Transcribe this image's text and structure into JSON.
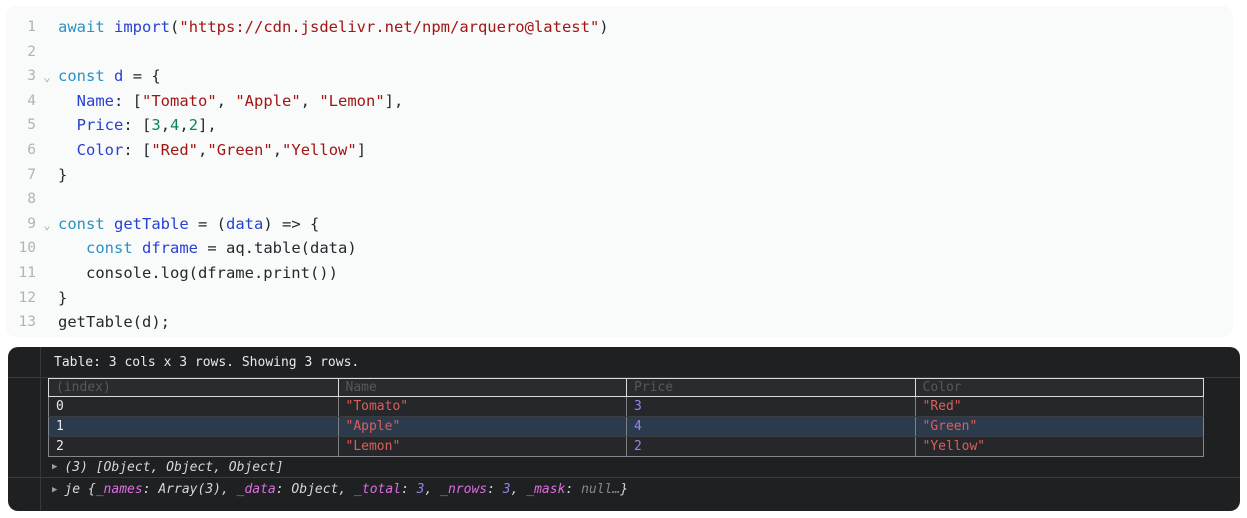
{
  "editor": {
    "fold_icon": "⌄",
    "lines": [
      {
        "num": "1",
        "fold": false,
        "tokens": [
          [
            "kw",
            "await"
          ],
          [
            "pl",
            " "
          ],
          [
            "id",
            "import"
          ],
          [
            "pl",
            "("
          ],
          [
            "str",
            "\"https://cdn.jsdelivr.net/npm/arquero@latest\""
          ],
          [
            "pl",
            ")"
          ]
        ]
      },
      {
        "num": "2",
        "fold": false,
        "tokens": []
      },
      {
        "num": "3",
        "fold": true,
        "tokens": [
          [
            "kw",
            "const"
          ],
          [
            "pl",
            " "
          ],
          [
            "id",
            "d"
          ],
          [
            "pl",
            " = {"
          ]
        ]
      },
      {
        "num": "4",
        "fold": false,
        "tokens": [
          [
            "pl",
            "  "
          ],
          [
            "id",
            "Name"
          ],
          [
            "pl",
            ": ["
          ],
          [
            "str",
            "\"Tomato\""
          ],
          [
            "pl",
            ", "
          ],
          [
            "str",
            "\"Apple\""
          ],
          [
            "pl",
            ", "
          ],
          [
            "str",
            "\"Lemon\""
          ],
          [
            "pl",
            "],"
          ]
        ]
      },
      {
        "num": "5",
        "fold": false,
        "tokens": [
          [
            "pl",
            "  "
          ],
          [
            "id",
            "Price"
          ],
          [
            "pl",
            ": ["
          ],
          [
            "num",
            "3"
          ],
          [
            "pl",
            ","
          ],
          [
            "num",
            "4"
          ],
          [
            "pl",
            ","
          ],
          [
            "num",
            "2"
          ],
          [
            "pl",
            "],"
          ]
        ]
      },
      {
        "num": "6",
        "fold": false,
        "tokens": [
          [
            "pl",
            "  "
          ],
          [
            "id",
            "Color"
          ],
          [
            "pl",
            ": ["
          ],
          [
            "str",
            "\"Red\""
          ],
          [
            "pl",
            ","
          ],
          [
            "str",
            "\"Green\""
          ],
          [
            "pl",
            ","
          ],
          [
            "str",
            "\"Yellow\""
          ],
          [
            "pl",
            "]"
          ]
        ]
      },
      {
        "num": "7",
        "fold": false,
        "tokens": [
          [
            "pl",
            "}"
          ]
        ]
      },
      {
        "num": "8",
        "fold": false,
        "tokens": []
      },
      {
        "num": "9",
        "fold": true,
        "tokens": [
          [
            "kw",
            "const"
          ],
          [
            "pl",
            " "
          ],
          [
            "id",
            "getTable"
          ],
          [
            "pl",
            " = ("
          ],
          [
            "id",
            "data"
          ],
          [
            "pl",
            ") => {"
          ]
        ]
      },
      {
        "num": "10",
        "fold": false,
        "tokens": [
          [
            "pl",
            "   "
          ],
          [
            "kw",
            "const"
          ],
          [
            "pl",
            " "
          ],
          [
            "id",
            "dframe"
          ],
          [
            "pl",
            " = aq.table(data)"
          ]
        ]
      },
      {
        "num": "11",
        "fold": false,
        "tokens": [
          [
            "pl",
            "   console.log(dframe.print())"
          ]
        ]
      },
      {
        "num": "12",
        "fold": false,
        "tokens": [
          [
            "pl",
            "}"
          ]
        ]
      },
      {
        "num": "13",
        "fold": false,
        "tokens": [
          [
            "pl",
            "getTable(d);"
          ]
        ]
      }
    ]
  },
  "console": {
    "expand_icon": "▶",
    "info_text": "Table: 3 cols x 3 rows. Showing 3 rows.",
    "table": {
      "headers": [
        "(index)",
        "Name",
        "Price",
        "Color"
      ],
      "rows": [
        {
          "highlight": false,
          "cells": [
            [
              "pl",
              "0"
            ],
            [
              "str",
              "\"Tomato\""
            ],
            [
              "num",
              "3"
            ],
            [
              "str",
              "\"Red\""
            ]
          ]
        },
        {
          "highlight": true,
          "cells": [
            [
              "pl",
              "1"
            ],
            [
              "str",
              "\"Apple\""
            ],
            [
              "num",
              "4"
            ],
            [
              "str",
              "\"Green\""
            ]
          ]
        },
        {
          "highlight": false,
          "cells": [
            [
              "pl",
              "2"
            ],
            [
              "str",
              "\"Lemon\""
            ],
            [
              "num",
              "2"
            ],
            [
              "str",
              "\"Yellow\""
            ]
          ]
        }
      ]
    },
    "array_preview": "(3) [Object, Object, Object]",
    "object_preview_tokens": [
      [
        "val",
        "je {"
      ],
      [
        "key",
        "_names"
      ],
      [
        "val",
        ": Array(3), "
      ],
      [
        "key",
        "_data"
      ],
      [
        "val",
        ": Object, "
      ],
      [
        "key",
        "_total"
      ],
      [
        "val",
        ": "
      ],
      [
        "num",
        "3"
      ],
      [
        "val",
        ", "
      ],
      [
        "key",
        "_nrows"
      ],
      [
        "val",
        ": "
      ],
      [
        "num",
        "3"
      ],
      [
        "val",
        ", "
      ],
      [
        "key",
        "_mask"
      ],
      [
        "val",
        ": "
      ],
      [
        "null",
        "null…"
      ],
      [
        "val",
        "}"
      ]
    ]
  },
  "colors": {
    "editor_background": "#f9fafa",
    "console_background": "#1e2022",
    "code_keyword": "#2b93c4",
    "code_identifier": "#2840d4",
    "code_string": "#a31515",
    "code_number": "#098658",
    "console_string": "#dc5f58",
    "console_number": "#9583f0",
    "console_property_key": "#de6ce2",
    "highlight_row": "#2c3a4e"
  }
}
